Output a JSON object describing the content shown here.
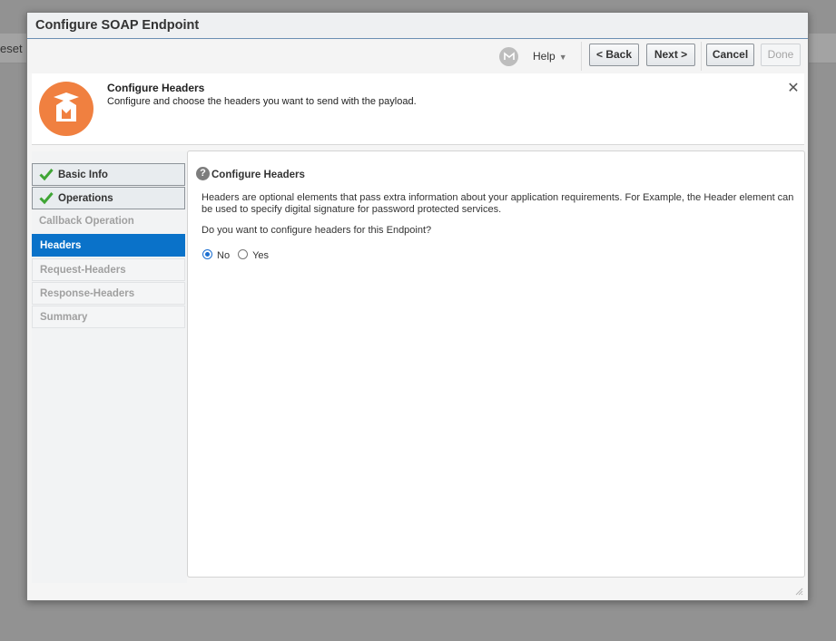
{
  "background": {
    "partial_text": "eset"
  },
  "dialog": {
    "title": "Configure SOAP Endpoint",
    "toolbar": {
      "help_label": "Help",
      "back_label": "< Back",
      "next_label": "Next >",
      "cancel_label": "Cancel",
      "done_label": "Done"
    },
    "header": {
      "title": "Configure Headers",
      "description": "Configure and choose the headers you want to send with the payload."
    },
    "train": {
      "steps": [
        {
          "label": "Basic Info",
          "state": "completed"
        },
        {
          "label": "Operations",
          "state": "completed"
        },
        {
          "label": "Callback Operation",
          "state": "skipped"
        },
        {
          "label": "Headers",
          "state": "current"
        },
        {
          "label": "Request-Headers",
          "state": "pending"
        },
        {
          "label": "Response-Headers",
          "state": "pending"
        },
        {
          "label": "Summary",
          "state": "pending"
        }
      ]
    },
    "content": {
      "section_title": "Configure Headers",
      "paragraph": "Headers are optional elements that pass extra information about your application requirements. For Example, the Header element can be used to specify digital signature for password protected services.",
      "question": "Do you want to configure headers for this Endpoint?",
      "options": [
        {
          "label": "No",
          "selected": true
        },
        {
          "label": "Yes",
          "selected": false
        }
      ]
    }
  },
  "colors": {
    "accent": "#0a72c9",
    "badge": "#f08040",
    "check": "#3fa535"
  },
  "icons": [
    "oracle-icon",
    "chevron-down-icon",
    "close-icon",
    "checkmark-icon",
    "question-icon",
    "graduation-cap-icon",
    "resize-grip-icon"
  ]
}
